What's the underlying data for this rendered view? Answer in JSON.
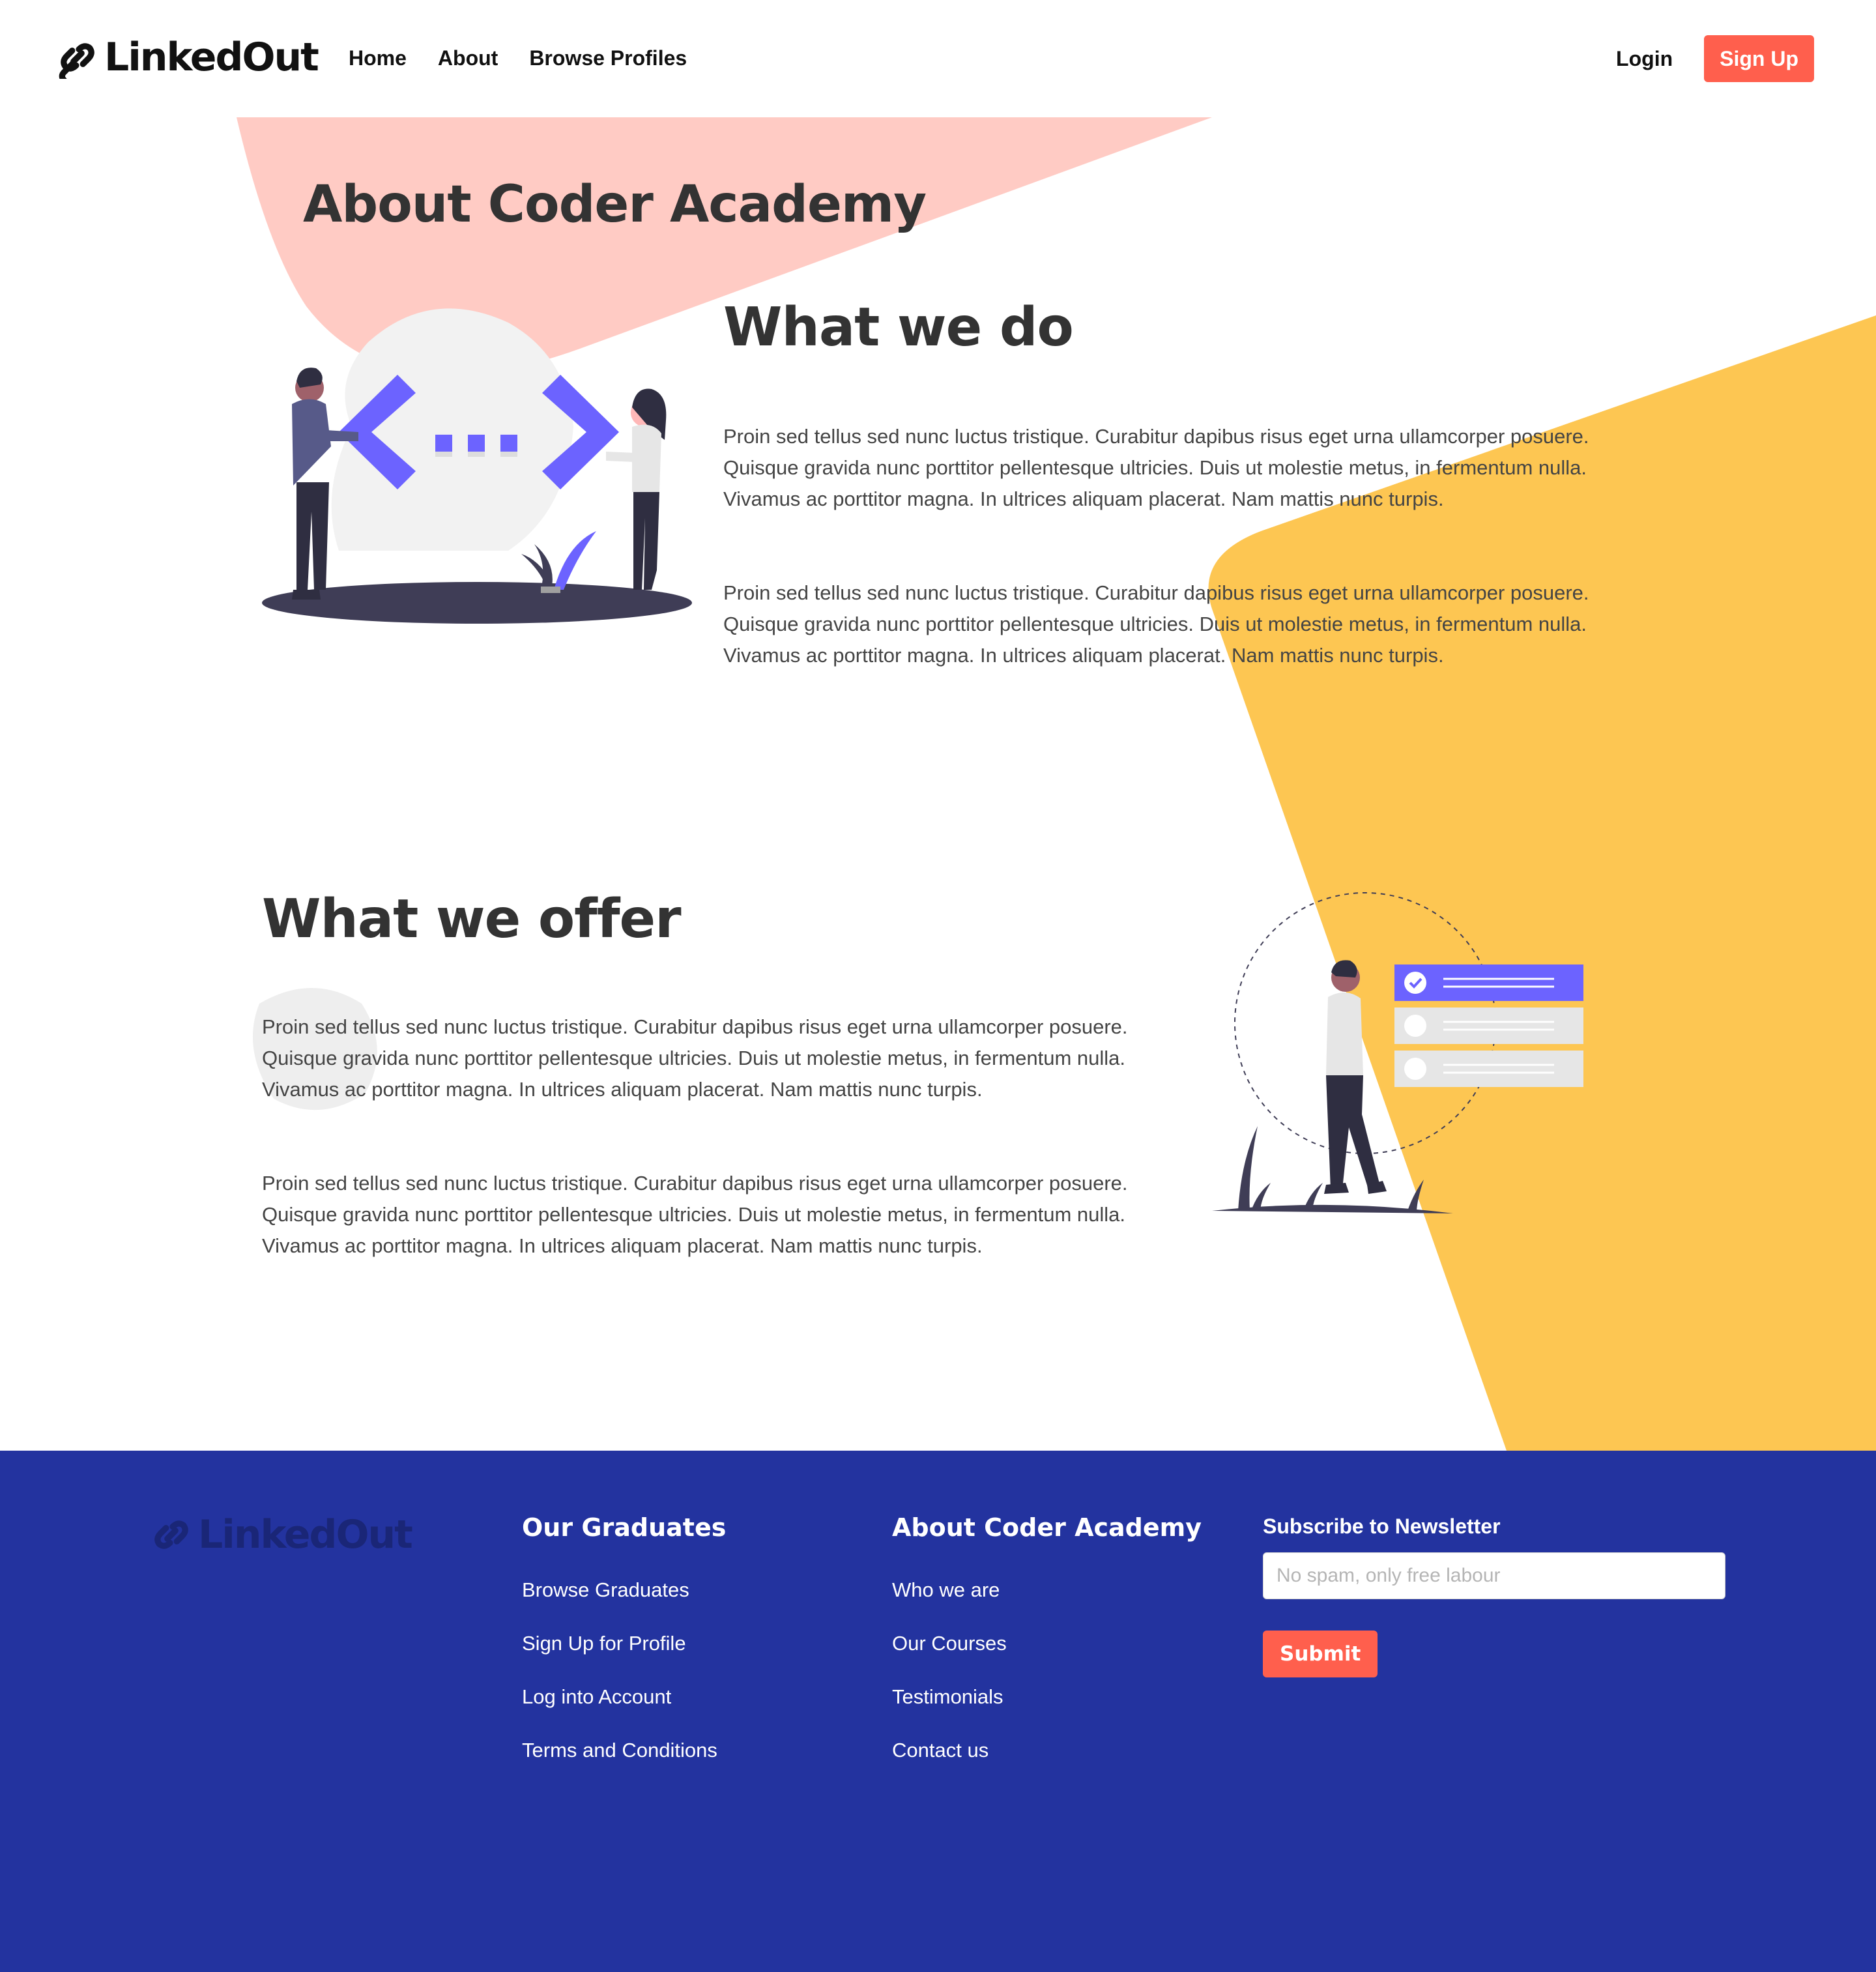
{
  "colors": {
    "accent": "#ff5f4d",
    "pink_shape": "#ffcbc4",
    "yellow_shape": "#fdc652",
    "illustration_purple": "#6c63ff",
    "footer_bg": "#23339f",
    "text_dark": "#333333"
  },
  "navbar": {
    "logo_icon": "link-icon",
    "logo_text": "LinkedOut",
    "links": [
      "Home",
      "About",
      "Browse Profiles"
    ],
    "login_label": "Login",
    "signup_label": "Sign Up"
  },
  "main": {
    "title": "About Coder Academy",
    "what_we_do": {
      "heading": "What we do",
      "paragraphs": [
        "Proin sed tellus sed nunc luctus tristique. Curabitur dapibus risus eget urna ullamcorper posuere. Quisque gravida nunc porttitor pellentesque ultricies. Duis ut molestie metus, in fermentum nulla. Vivamus ac porttitor magna. In ultrices aliquam placerat. Nam mattis nunc turpis.",
        "Proin sed tellus sed nunc luctus tristique. Curabitur dapibus risus eget urna ullamcorper posuere. Quisque gravida nunc porttitor pellentesque ultricies. Duis ut molestie metus, in fermentum nulla. Vivamus ac porttitor magna. In ultrices aliquam placerat. Nam mattis nunc turpis."
      ]
    },
    "what_we_offer": {
      "heading": "What we offer",
      "paragraphs": [
        "Proin sed tellus sed nunc luctus tristique. Curabitur dapibus risus eget urna ullamcorper posuere. Quisque gravida nunc porttitor pellentesque ultricies. Duis ut molestie metus, in fermentum nulla. Vivamus ac porttitor magna. In ultrices aliquam placerat. Nam mattis nunc turpis.",
        "Proin sed tellus sed nunc luctus tristique. Curabitur dapibus risus eget urna ullamcorper posuere. Quisque gravida nunc porttitor pellentesque ultricies. Duis ut molestie metus, in fermentum nulla. Vivamus ac porttitor magna. In ultrices aliquam placerat. Nam mattis nunc turpis."
      ]
    }
  },
  "footer": {
    "logo_text": "LinkedOut",
    "graduates": {
      "heading": "Our Graduates",
      "links": [
        "Browse Graduates",
        "Sign Up for Profile",
        "Log into Account",
        "Terms and Conditions"
      ]
    },
    "about": {
      "heading": "About Coder Academy",
      "links": [
        "Who we are",
        "Our Courses",
        "Testimonials",
        "Contact us"
      ]
    },
    "newsletter": {
      "heading": "Subscribe to Newsletter",
      "placeholder": "No spam, only free labour",
      "value": "",
      "submit_label": "Submit"
    }
  }
}
